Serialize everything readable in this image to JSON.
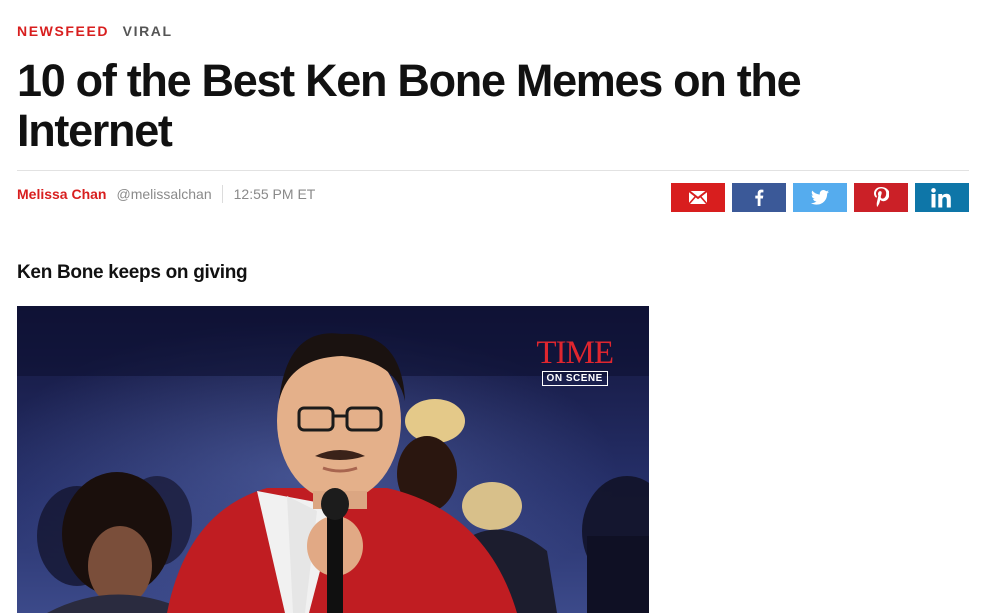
{
  "breadcrumb": {
    "section": "NEWSFEED",
    "category": "VIRAL"
  },
  "article": {
    "title": "10 of the Best Ken Bone Memes on the Internet",
    "subheading": "Ken Bone keeps on giving"
  },
  "byline": {
    "author": "Melissa Chan",
    "handle": "@melissalchan",
    "time": "12:55 PM ET"
  },
  "share": {
    "buttons": [
      {
        "network": "email",
        "icon": "envelope-icon",
        "color": "#d81e1e"
      },
      {
        "network": "facebook",
        "icon": "facebook-icon",
        "color": "#3b5998"
      },
      {
        "network": "twitter",
        "icon": "twitter-icon",
        "color": "#55acee"
      },
      {
        "network": "pinterest",
        "icon": "pinterest-icon",
        "color": "#cb2027"
      },
      {
        "network": "linkedin",
        "icon": "linkedin-icon",
        "color": "#0e76a8"
      }
    ]
  },
  "video": {
    "logo_word": "TIME",
    "logo_tag": "ON SCENE"
  },
  "colors": {
    "accent": "#d81e1e",
    "muted": "#8a8a8a"
  }
}
